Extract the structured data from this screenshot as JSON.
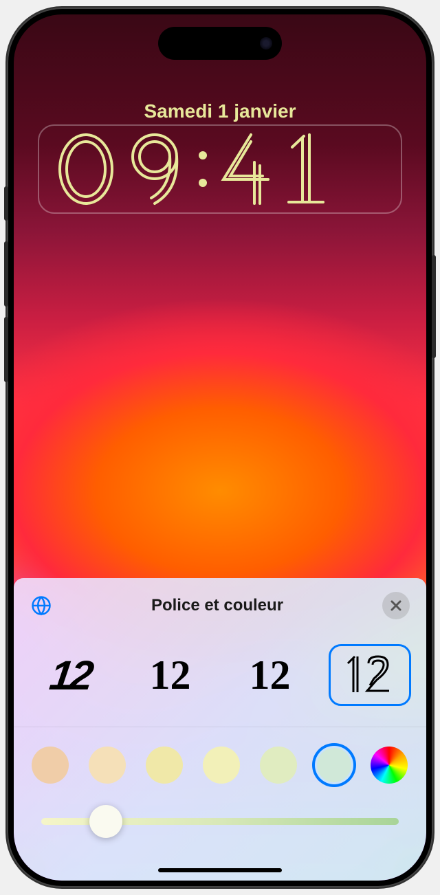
{
  "lockscreen": {
    "date": "Samedi 1 janvier",
    "time": "09:41"
  },
  "panel": {
    "title": "Police et couleur",
    "fonts": [
      {
        "sample": "12",
        "style": "stencil-italic"
      },
      {
        "sample": "12",
        "style": "serif-bold"
      },
      {
        "sample": "12",
        "style": "serif-black"
      },
      {
        "sample": "12",
        "style": "outline-inline",
        "selected": true
      }
    ],
    "colors": [
      {
        "hex": "#f0cda8",
        "selected": false
      },
      {
        "hex": "#f5e0b8",
        "selected": false
      },
      {
        "hex": "#f0e8a8",
        "selected": false
      },
      {
        "hex": "#f2f0b8",
        "selected": false
      },
      {
        "hex": "#e0ecc0",
        "selected": false
      },
      {
        "hex": "#d0e8d8",
        "selected": true
      }
    ],
    "slider_value": 18
  }
}
